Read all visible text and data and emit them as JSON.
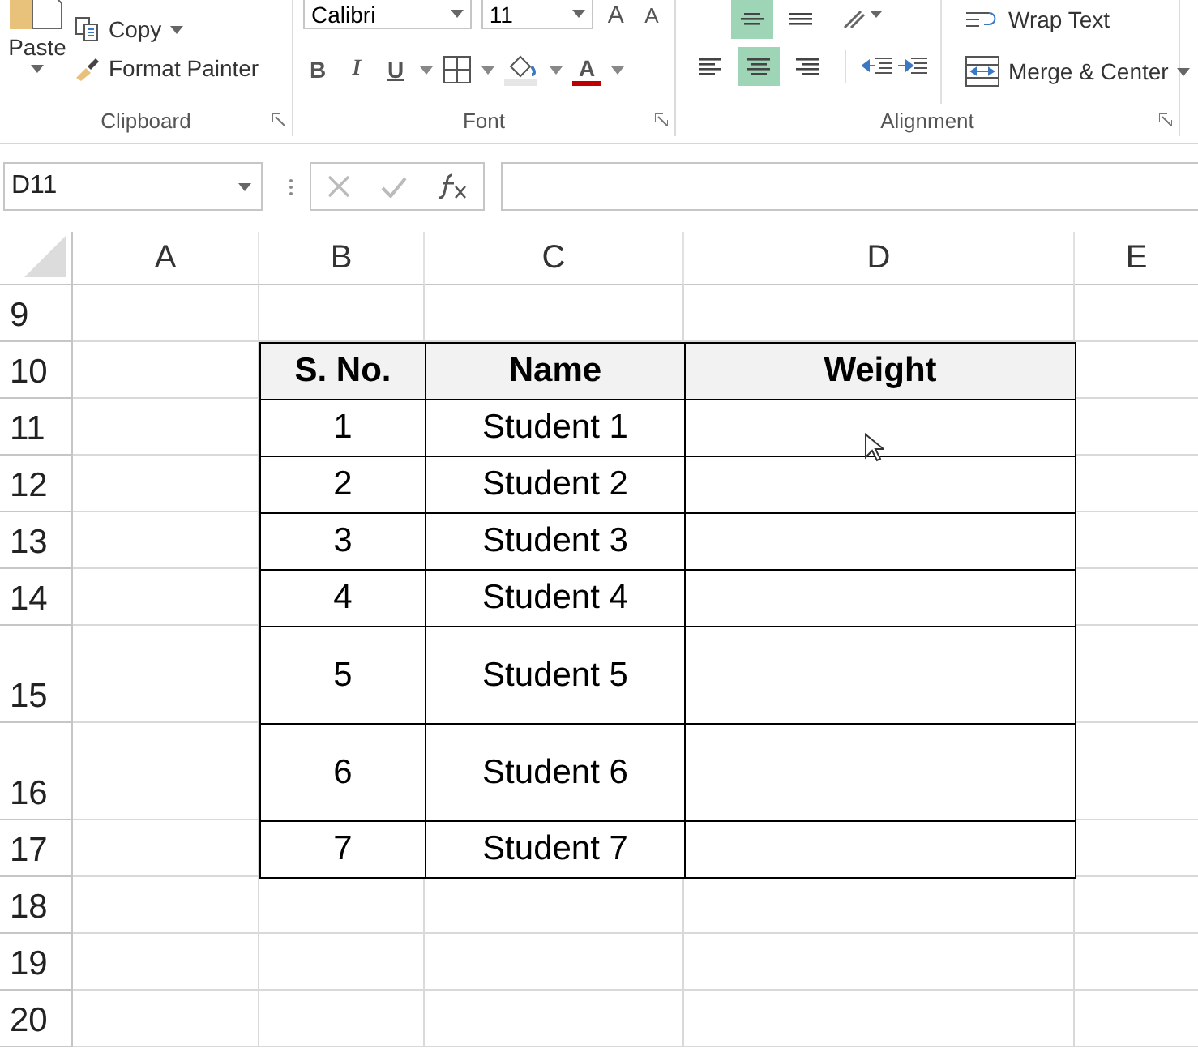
{
  "ribbon": {
    "clipboard": {
      "paste": "Paste",
      "copy": "Copy",
      "format_painter": "Format Painter",
      "label": "Clipboard"
    },
    "font": {
      "font_name": "Calibri",
      "font_size": "11",
      "grow": "A",
      "shrink": "A",
      "bold": "B",
      "italic": "I",
      "underline": "U",
      "font_color": "A",
      "label": "Font"
    },
    "alignment": {
      "top_row": [
        {
          "kind": "middle",
          "selected": true
        },
        {
          "kind": "bottom",
          "selected": false
        }
      ],
      "bottom_row": [
        {
          "kind": "left",
          "selected": false
        },
        {
          "kind": "center",
          "selected": true
        },
        {
          "kind": "right",
          "selected": false
        }
      ],
      "wrap_text": "Wrap Text",
      "merge_center": "Merge & Center",
      "label": "Alignment"
    }
  },
  "formula_bar": {
    "name_box": "D11"
  },
  "columns": [
    "A",
    "B",
    "C",
    "D",
    "E"
  ],
  "rows": [
    {
      "header": "9",
      "kind": "empty",
      "tall": false
    },
    {
      "header": "10",
      "kind": "header",
      "tall": false,
      "cells": [
        "S. No.",
        "Name",
        "Weight"
      ]
    },
    {
      "header": "11",
      "kind": "data",
      "tall": false,
      "cells": [
        "1",
        "Student 1"
      ]
    },
    {
      "header": "12",
      "kind": "data",
      "tall": false,
      "cells": [
        "2",
        "Student 2"
      ]
    },
    {
      "header": "13",
      "kind": "data",
      "tall": false,
      "cells": [
        "3",
        "Student 3"
      ]
    },
    {
      "header": "14",
      "kind": "data",
      "tall": false,
      "cells": [
        "4",
        "Student 4"
      ]
    },
    {
      "header": "15",
      "kind": "data",
      "tall": true,
      "cells": [
        "5",
        "Student 5"
      ]
    },
    {
      "header": "16",
      "kind": "data",
      "tall": true,
      "cells": [
        "6",
        "Student 6"
      ]
    },
    {
      "header": "17",
      "kind": "data",
      "tall": false,
      "cells": [
        "7",
        "Student 7"
      ]
    },
    {
      "header": "18",
      "kind": "empty",
      "tall": false
    },
    {
      "header": "19",
      "kind": "empty",
      "tall": false
    },
    {
      "header": "20",
      "kind": "empty",
      "tall": false
    }
  ]
}
